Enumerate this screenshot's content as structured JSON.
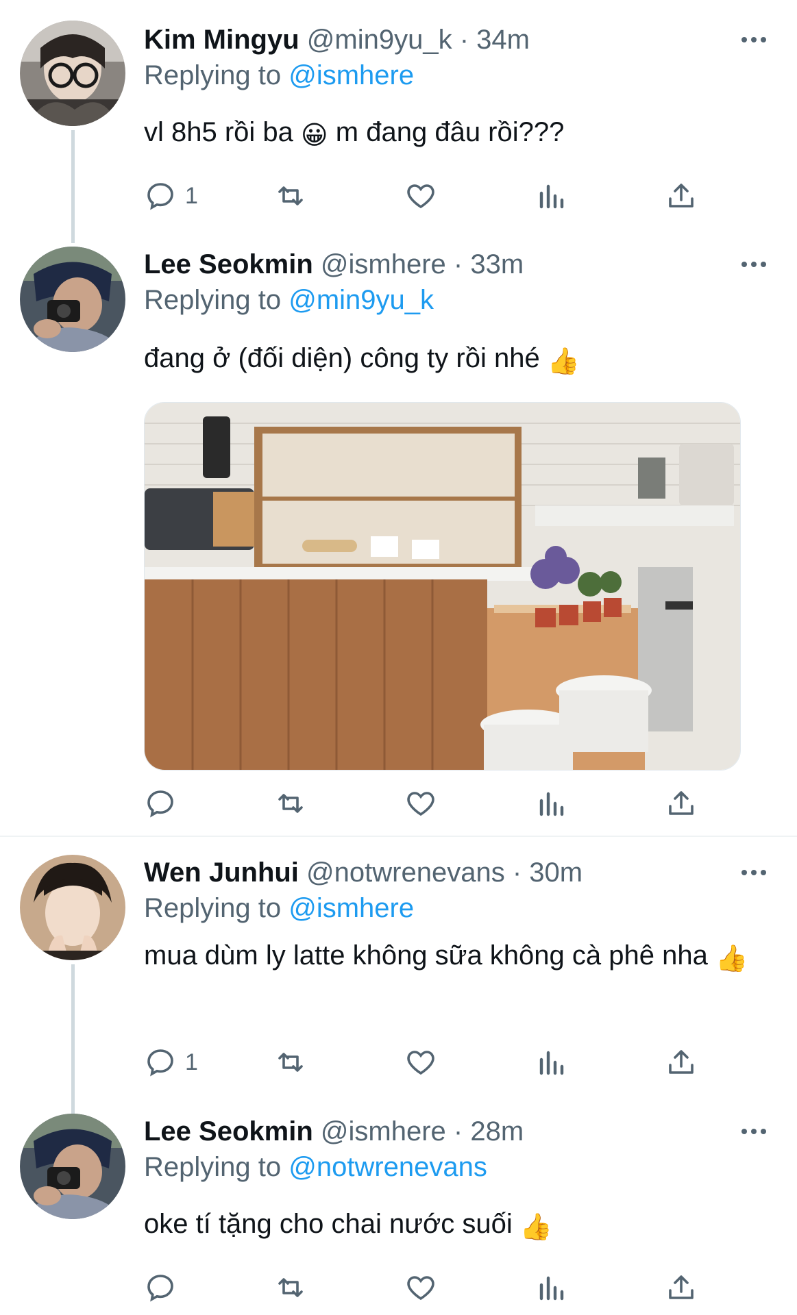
{
  "colors": {
    "accent": "#1d9bf0",
    "secondary_text": "#536471",
    "thread_line": "#cfd9de"
  },
  "tweets": [
    {
      "name": "Kim Mingyu",
      "handle": "@min9yu_k",
      "dot": "·",
      "time": "34m",
      "replying_prefix": "Replying to ",
      "replying_to": "@ismhere",
      "text": "vl 8h5 rồi ba",
      "emoji": "😀",
      "text_after": "m đang đâu rồi???",
      "reply_count": "1"
    },
    {
      "name": "Lee Seokmin",
      "handle": "@ismhere",
      "dot": "·",
      "time": "33m",
      "replying_prefix": "Replying to ",
      "replying_to": "@min9yu_k",
      "text": "đang ở (đối diện) công ty rồi nhé",
      "emoji": "👍",
      "media_icon": "cafe-counter-photo",
      "reply_count": ""
    },
    {
      "name": "Wen Junhui",
      "handle": "@notwrenevans",
      "dot": "·",
      "time": "30m",
      "replying_prefix": "Replying to ",
      "replying_to": "@ismhere",
      "text": "mua dùm ly latte không sữa không cà phê nha",
      "emoji": "👍",
      "reply_count": "1"
    },
    {
      "name": "Lee Seokmin",
      "handle": "@ismhere",
      "dot": "·",
      "time": "28m",
      "replying_prefix": "Replying to ",
      "replying_to": "@notwrenevans",
      "text": "oke tí tặng cho chai nước suối",
      "emoji": "👍",
      "reply_count": ""
    }
  ]
}
